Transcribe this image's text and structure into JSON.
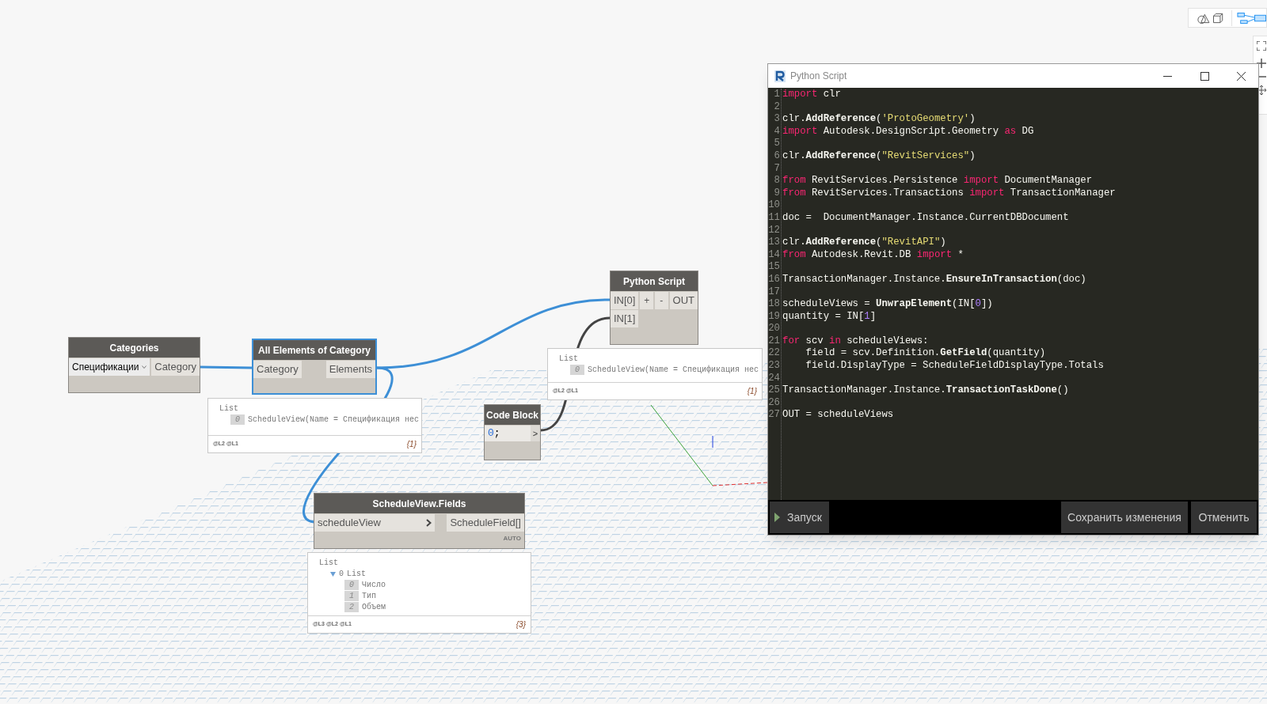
{
  "categories_node": {
    "title": "Categories",
    "selected": false,
    "dropdown": "Спецификации",
    "outputs": [
      "Category"
    ]
  },
  "all_elements_node": {
    "title": "All Elements of Category",
    "selected": true,
    "inputs": [
      "Category"
    ],
    "outputs": [
      "Elements"
    ]
  },
  "python_node": {
    "title": "Python Script",
    "selected": false,
    "inputs": [
      "IN[0]",
      "IN[1]"
    ],
    "add_button": "+",
    "remove_button": "-",
    "outputs": [
      "OUT"
    ]
  },
  "code_block_node": {
    "title": "Code Block",
    "selected": false,
    "code": "0;",
    "output": ">"
  },
  "fields_node": {
    "title": "ScheduleView.Fields",
    "selected": false,
    "inputs": [
      "scheduleView"
    ],
    "outputs": [
      "ScheduleField[]"
    ],
    "lacing": "AUTO"
  },
  "previews": [
    {
      "header": "List",
      "items": [
        {
          "index": "0",
          "text": "ScheduleView(Name = Спецификация нес"
        }
      ],
      "levels": "@L2 @L1",
      "count": "{1}"
    },
    {
      "header": "List",
      "items": [
        {
          "index": "0",
          "text": "ScheduleView(Name = Спецификация нес"
        }
      ],
      "levels": "@L2 @L1",
      "count": "{1}"
    },
    {
      "header": "List",
      "items": [
        {
          "index": "0",
          "text": "List",
          "expanded": true,
          "children": [
            {
              "index": "0",
              "text": "Число"
            },
            {
              "index": "1",
              "text": "Тип"
            },
            {
              "index": "2",
              "text": "Объем"
            }
          ]
        }
      ],
      "levels": "@L3 @L2 @L1",
      "count": "{3}"
    }
  ],
  "editor": {
    "title": "Python Script",
    "lines": [
      {
        "number": "1",
        "segments": [
          {
            "kind": "kw",
            "text": "import"
          },
          {
            "kind": "t",
            "text": " clr"
          }
        ]
      },
      {
        "number": "2"
      },
      {
        "number": "3",
        "segments": [
          {
            "kind": "t",
            "text": "clr."
          },
          {
            "kind": "fn",
            "text": "AddReference"
          },
          {
            "kind": "t",
            "text": "("
          },
          {
            "kind": "str",
            "text": "'ProtoGeometry'"
          },
          {
            "kind": "t",
            "text": ")"
          }
        ]
      },
      {
        "number": "4",
        "segments": [
          {
            "kind": "kw",
            "text": "import"
          },
          {
            "kind": "t",
            "text": " Autodesk.DesignScript.Geometry "
          },
          {
            "kind": "kw",
            "text": "as"
          },
          {
            "kind": "t",
            "text": " DG"
          }
        ]
      },
      {
        "number": "5"
      },
      {
        "number": "6",
        "segments": [
          {
            "kind": "t",
            "text": "clr."
          },
          {
            "kind": "fn",
            "text": "AddReference"
          },
          {
            "kind": "t",
            "text": "("
          },
          {
            "kind": "str",
            "text": "\"RevitServices\""
          },
          {
            "kind": "t",
            "text": ")"
          }
        ]
      },
      {
        "number": "7"
      },
      {
        "number": "8",
        "segments": [
          {
            "kind": "kw",
            "text": "from"
          },
          {
            "kind": "t",
            "text": " RevitServices.Persistence "
          },
          {
            "kind": "kw",
            "text": "import"
          },
          {
            "kind": "t",
            "text": " DocumentManager"
          }
        ]
      },
      {
        "number": "9",
        "segments": [
          {
            "kind": "kw",
            "text": "from"
          },
          {
            "kind": "t",
            "text": " RevitServices.Transactions "
          },
          {
            "kind": "kw",
            "text": "import"
          },
          {
            "kind": "t",
            "text": " TransactionManager"
          }
        ]
      },
      {
        "number": "10"
      },
      {
        "number": "11",
        "segments": [
          {
            "kind": "t",
            "text": "doc =  DocumentManager.Instance.CurrentDBDocument"
          }
        ]
      },
      {
        "number": "12"
      },
      {
        "number": "13",
        "segments": [
          {
            "kind": "t",
            "text": "clr."
          },
          {
            "kind": "fn",
            "text": "AddReference"
          },
          {
            "kind": "t",
            "text": "("
          },
          {
            "kind": "str",
            "text": "\"RevitAPI\""
          },
          {
            "kind": "t",
            "text": ")"
          }
        ]
      },
      {
        "number": "14",
        "segments": [
          {
            "kind": "kw",
            "text": "from"
          },
          {
            "kind": "t",
            "text": " Autodesk.Revit.DB "
          },
          {
            "kind": "kw",
            "text": "import"
          },
          {
            "kind": "t",
            "text": " *"
          }
        ]
      },
      {
        "number": "15"
      },
      {
        "number": "16",
        "segments": [
          {
            "kind": "t",
            "text": "TransactionManager.Instance."
          },
          {
            "kind": "fn",
            "text": "EnsureInTransaction"
          },
          {
            "kind": "t",
            "text": "(doc)"
          }
        ]
      },
      {
        "number": "17"
      },
      {
        "number": "18",
        "segments": [
          {
            "kind": "t",
            "text": "scheduleViews = "
          },
          {
            "kind": "fn",
            "text": "UnwrapElement"
          },
          {
            "kind": "t",
            "text": "(IN["
          },
          {
            "kind": "num",
            "text": "0"
          },
          {
            "kind": "t",
            "text": "])"
          }
        ]
      },
      {
        "number": "19",
        "segments": [
          {
            "kind": "t",
            "text": "quantity = IN["
          },
          {
            "kind": "num",
            "text": "1"
          },
          {
            "kind": "t",
            "text": "]"
          }
        ]
      },
      {
        "number": "20"
      },
      {
        "number": "21",
        "segments": [
          {
            "kind": "kw",
            "text": "for"
          },
          {
            "kind": "t",
            "text": " scv "
          },
          {
            "kind": "kw",
            "text": "in"
          },
          {
            "kind": "t",
            "text": " scheduleViews:"
          }
        ]
      },
      {
        "number": "22",
        "segments": [
          {
            "kind": "t",
            "text": "    field = scv.Definition."
          },
          {
            "kind": "fn",
            "text": "GetField"
          },
          {
            "kind": "t",
            "text": "(quantity)"
          }
        ]
      },
      {
        "number": "23",
        "segments": [
          {
            "kind": "t",
            "text": "    field.DisplayType = ScheduleFieldDisplayType.Totals"
          }
        ]
      },
      {
        "number": "24"
      },
      {
        "number": "25",
        "segments": [
          {
            "kind": "t",
            "text": "TransactionManager.Instance."
          },
          {
            "kind": "fn",
            "text": "TransactionTaskDone"
          },
          {
            "kind": "t",
            "text": "()"
          }
        ]
      },
      {
        "number": "26"
      },
      {
        "number": "27",
        "segments": [
          {
            "kind": "t",
            "text": "OUT = scheduleViews"
          }
        ]
      }
    ],
    "run_button": "Запуск",
    "save_button": "Сохранить изменения",
    "cancel_button": "Отменить"
  }
}
